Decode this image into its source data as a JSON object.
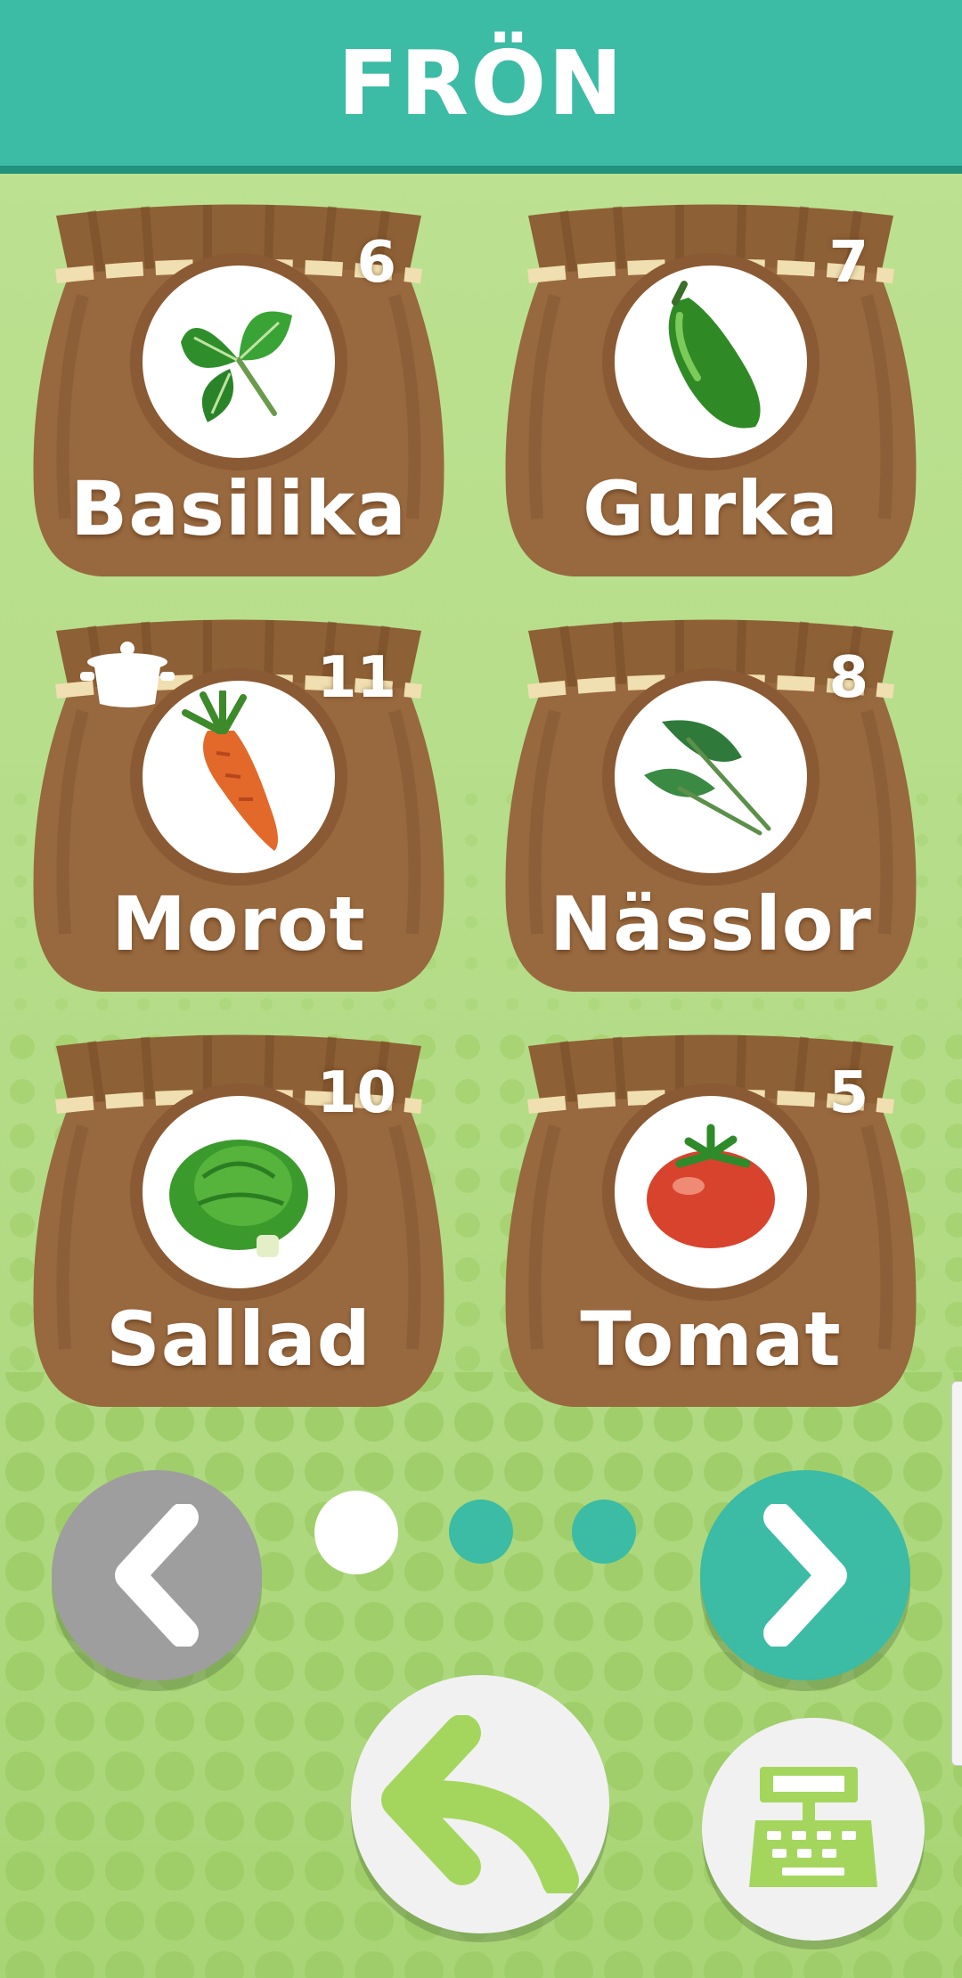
{
  "header": {
    "title": "FRÖN"
  },
  "seeds": [
    {
      "name": "Basilika",
      "count": "6",
      "icon": "basil-leaf-icon"
    },
    {
      "name": "Gurka",
      "count": "7",
      "icon": "cucumber-icon"
    },
    {
      "name": "Morot",
      "count": "11",
      "icon": "carrot-icon",
      "badge": "pot-icon"
    },
    {
      "name": "Nässlor",
      "count": "8",
      "icon": "nettle-icon"
    },
    {
      "name": "Sallad",
      "count": "10",
      "icon": "lettuce-icon"
    },
    {
      "name": "Tomat",
      "count": "5",
      "icon": "tomato-icon"
    }
  ],
  "pagination": {
    "current_page": 1,
    "total_pages": 3
  },
  "colors": {
    "header": "#3cbba5",
    "sack": "#98683e",
    "nav_prev": "#9e9e9e",
    "nav_next": "#3cbba5",
    "accent_green": "#a4d65e"
  }
}
